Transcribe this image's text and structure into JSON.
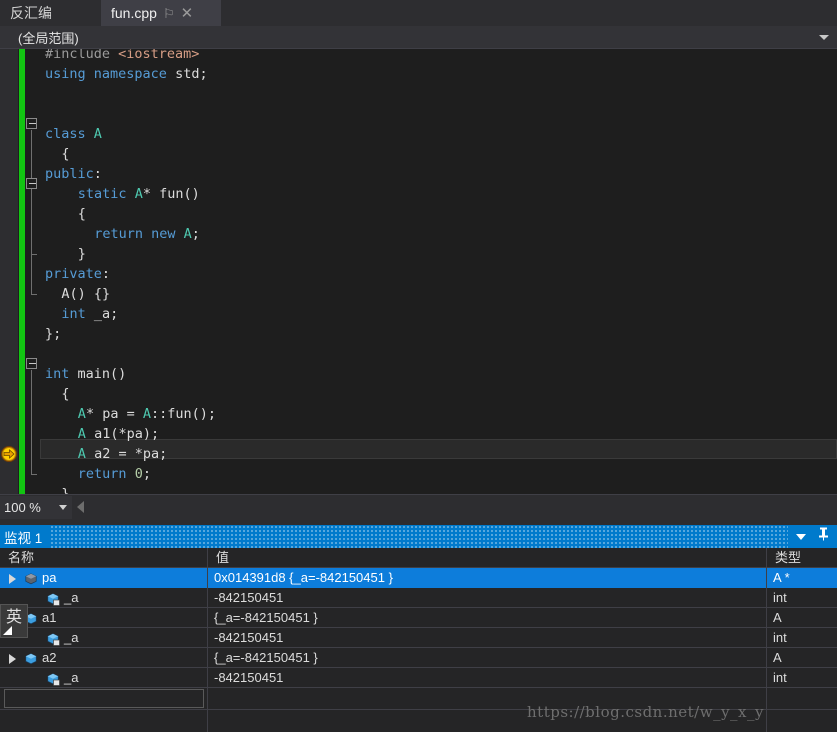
{
  "tabs": {
    "disassembly_label": "反汇编",
    "active_file": "fun.cpp",
    "pin_icon": "pin-icon",
    "close_icon": "close-icon"
  },
  "scopebar": {
    "scope": "(全局范围)",
    "caret_icon": "chevron-down-icon"
  },
  "editor": {
    "zoom_level": "100 %",
    "current_line_index": 17,
    "lines": [
      {
        "indent": 0,
        "tokens": [
          {
            "t": "#include ",
            "c": "pre"
          },
          {
            "t": "<iostream>",
            "c": "str"
          }
        ]
      },
      {
        "indent": 0,
        "tokens": [
          {
            "t": "using",
            "c": "kw"
          },
          {
            "t": " ",
            "c": "plain"
          },
          {
            "t": "namespace",
            "c": "kw"
          },
          {
            "t": " std;",
            "c": "plain"
          }
        ]
      },
      {
        "indent": 0,
        "tokens": []
      },
      {
        "indent": 0,
        "tokens": []
      },
      {
        "indent": 0,
        "tokens": [
          {
            "t": "class",
            "c": "kw"
          },
          {
            "t": " ",
            "c": "plain"
          },
          {
            "t": "A",
            "c": "typ"
          }
        ]
      },
      {
        "indent": 1,
        "tokens": [
          {
            "t": "{",
            "c": "plain"
          }
        ]
      },
      {
        "indent": 0,
        "tokens": [
          {
            "t": "public",
            "c": "kw"
          },
          {
            "t": ":",
            "c": "plain"
          }
        ]
      },
      {
        "indent": 2,
        "tokens": [
          {
            "t": "static",
            "c": "kw"
          },
          {
            "t": " ",
            "c": "plain"
          },
          {
            "t": "A",
            "c": "typ"
          },
          {
            "t": "* fun()",
            "c": "plain"
          }
        ]
      },
      {
        "indent": 2,
        "tokens": [
          {
            "t": "{",
            "c": "plain"
          }
        ]
      },
      {
        "indent": 3,
        "tokens": [
          {
            "t": "return",
            "c": "kw"
          },
          {
            "t": " ",
            "c": "plain"
          },
          {
            "t": "new",
            "c": "kw"
          },
          {
            "t": " ",
            "c": "plain"
          },
          {
            "t": "A",
            "c": "typ"
          },
          {
            "t": ";",
            "c": "plain"
          }
        ]
      },
      {
        "indent": 2,
        "tokens": [
          {
            "t": "}",
            "c": "plain"
          }
        ]
      },
      {
        "indent": 0,
        "tokens": [
          {
            "t": "private",
            "c": "kw"
          },
          {
            "t": ":",
            "c": "plain"
          }
        ]
      },
      {
        "indent": 1,
        "tokens": [
          {
            "t": "A() {}",
            "c": "plain"
          }
        ]
      },
      {
        "indent": 1,
        "tokens": [
          {
            "t": "int",
            "c": "kw"
          },
          {
            "t": " _a;",
            "c": "plain"
          }
        ]
      },
      {
        "indent": 0,
        "tokens": [
          {
            "t": "};",
            "c": "plain"
          }
        ]
      },
      {
        "indent": 0,
        "tokens": []
      },
      {
        "indent": 0,
        "tokens": [
          {
            "t": "int",
            "c": "kw"
          },
          {
            "t": " main()",
            "c": "plain"
          }
        ]
      },
      {
        "indent": 1,
        "tokens": [
          {
            "t": "{",
            "c": "plain"
          }
        ]
      },
      {
        "indent": 2,
        "tokens": [
          {
            "t": "A",
            "c": "typ"
          },
          {
            "t": "* pa = ",
            "c": "plain"
          },
          {
            "t": "A",
            "c": "typ"
          },
          {
            "t": "::fun();",
            "c": "plain"
          }
        ]
      },
      {
        "indent": 2,
        "tokens": [
          {
            "t": "A",
            "c": "typ"
          },
          {
            "t": " a1(*pa);",
            "c": "plain"
          }
        ]
      },
      {
        "indent": 2,
        "tokens": [
          {
            "t": "A",
            "c": "typ"
          },
          {
            "t": " a2 = *pa;",
            "c": "plain"
          }
        ]
      },
      {
        "indent": 2,
        "tokens": [
          {
            "t": "return",
            "c": "kw"
          },
          {
            "t": " ",
            "c": "plain"
          },
          {
            "t": "0",
            "c": "num"
          },
          {
            "t": ";",
            "c": "plain"
          }
        ]
      },
      {
        "indent": 1,
        "tokens": [
          {
            "t": "}",
            "c": "plain"
          }
        ]
      }
    ]
  },
  "watch": {
    "title": "监视 1",
    "caret_icon": "chevron-down-icon",
    "pin_icon": "pin-icon",
    "columns": [
      "名称",
      "值",
      "类型"
    ],
    "rows": [
      {
        "depth": 0,
        "expandable": true,
        "icon": "pointer-variable-icon",
        "name": "pa",
        "value": "0x014391d8 {_a=-842150451 }",
        "type": "A *",
        "selected": true
      },
      {
        "depth": 1,
        "expandable": false,
        "icon": "private-field-icon",
        "name": "_a",
        "value": "-842150451",
        "type": "int",
        "selected": false
      },
      {
        "depth": 0,
        "expandable": true,
        "icon": "object-variable-icon",
        "name": "a1",
        "value": "{_a=-842150451 }",
        "type": "A",
        "selected": false
      },
      {
        "depth": 1,
        "expandable": false,
        "icon": "private-field-icon",
        "name": "_a",
        "value": "-842150451",
        "type": "int",
        "selected": false
      },
      {
        "depth": 0,
        "expandable": true,
        "icon": "object-variable-icon",
        "name": "a2",
        "value": "{_a=-842150451 }",
        "type": "A",
        "selected": false
      },
      {
        "depth": 1,
        "expandable": false,
        "icon": "private-field-icon",
        "name": "_a",
        "value": "-842150451",
        "type": "int",
        "selected": false
      }
    ],
    "new_row_placeholder": ""
  },
  "ime": {
    "mode": "英"
  },
  "watermark": "https://blog.csdn.net/w_y_x_y",
  "colors": {
    "accent": "#007acc",
    "selection": "#0d7ddb",
    "editor_bg": "#1e1e1e",
    "chrome_bg": "#2d2d30",
    "change_bar": "#12c512",
    "keyword": "#569cd6",
    "type": "#4ec9b0",
    "string": "#d69d85",
    "number": "#b5cea8"
  }
}
